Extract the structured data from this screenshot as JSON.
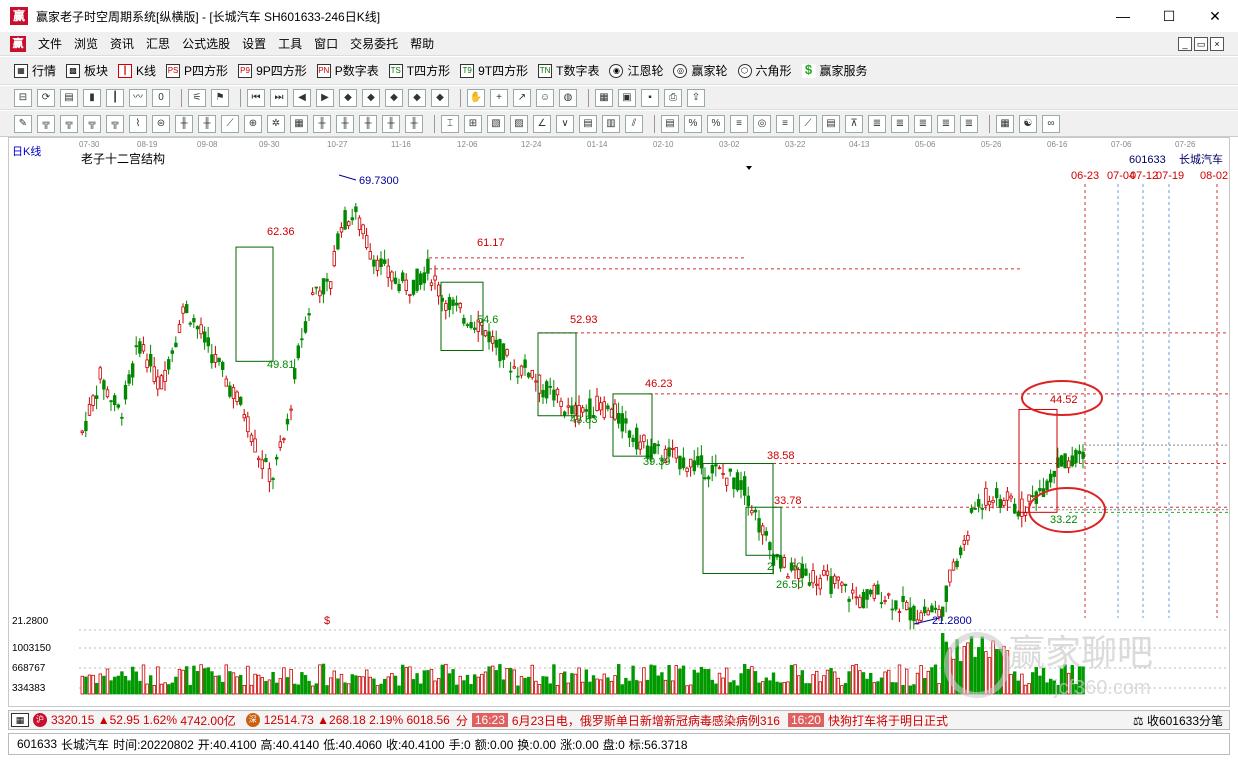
{
  "window": {
    "title": "赢家老子时空周期系统[纵横版] - [长城汽车  SH601633-246日K线]",
    "app_icon": "赢"
  },
  "menu": [
    "文件",
    "浏览",
    "资讯",
    "汇思",
    "公式选股",
    "设置",
    "工具",
    "窗口",
    "交易委托",
    "帮助"
  ],
  "toolbar1": [
    {
      "icon": "grid-icon",
      "label": "行情"
    },
    {
      "icon": "blocks-icon",
      "label": "板块"
    },
    {
      "icon": "kline-icon",
      "label": "K线"
    },
    {
      "icon": "ps-icon",
      "label": "P四方形"
    },
    {
      "icon": "p9-icon",
      "label": "9P四方形"
    },
    {
      "icon": "pn-icon",
      "label": "P数字表"
    },
    {
      "icon": "ts-icon",
      "label": "T四方形"
    },
    {
      "icon": "t9-icon",
      "label": "9T四方形"
    },
    {
      "icon": "tn-icon",
      "label": "T数字表"
    },
    {
      "icon": "wheel-icon",
      "label": "江恩轮"
    },
    {
      "icon": "winner-wheel-icon",
      "label": "赢家轮"
    },
    {
      "icon": "hexagon-icon",
      "label": "六角形"
    },
    {
      "icon": "dollar-icon",
      "label": "赢家服务"
    }
  ],
  "chart": {
    "period_label": "日K线",
    "indicator_title": "老子十二宫结构",
    "stock_code": "601633",
    "stock_name": "长城汽车",
    "date_axis": [
      "07-30",
      "08-19",
      "09-08",
      "09-30",
      "10-27",
      "11-16",
      "12-06",
      "12-24",
      "01-14",
      "02-10",
      "03-02",
      "03-22",
      "04-13",
      "05-06",
      "05-26",
      "06-16",
      "07-06",
      "07-26"
    ],
    "future_dates": [
      "06-23",
      "07-04",
      "07-12",
      "07-19",
      "08-02"
    ],
    "price_low_label": "21.2800",
    "volume_labels": [
      "1003150",
      "668767",
      "334383"
    ],
    "annotations": [
      "69.7300",
      "62.36",
      "61.17",
      "54.6",
      "52.93",
      "49.81",
      "46.23",
      "44.52",
      "43.83",
      "39.39",
      "38.58",
      "33.78",
      "33.22",
      "26.50",
      "21.2800"
    ],
    "watermark": "赢家聊吧",
    "watermark_url": "jcf360.com"
  },
  "status": {
    "index1_value": "3320.15",
    "index1_change": "▲52.95",
    "index1_pct": "1.62%",
    "index1_amount": "4742.00亿",
    "index2_value": "12514.73",
    "index2_change": "▲268.18",
    "index2_pct": "2.19%",
    "index2_amount": "6018.56",
    "news1_time": "16:23",
    "news1_text": "6月23日电，俄罗斯单日新增新冠病毒感染病例316",
    "news2_time": "16:20",
    "news2_text": "快狗打车将于明日正式",
    "right_text": "收601633分笔"
  },
  "info": {
    "code": "601633",
    "name": "长城汽车",
    "time": "时间:20220802",
    "open": "开:40.4100",
    "high": "高:40.4140",
    "low": "低:40.4060",
    "close": "收:40.4100",
    "vol": "手:0",
    "amount": "额:0.00",
    "turnover": "换:0.00",
    "change": "涨:0.00",
    "disk": "盘:0",
    "mark": "标:56.3718"
  }
}
